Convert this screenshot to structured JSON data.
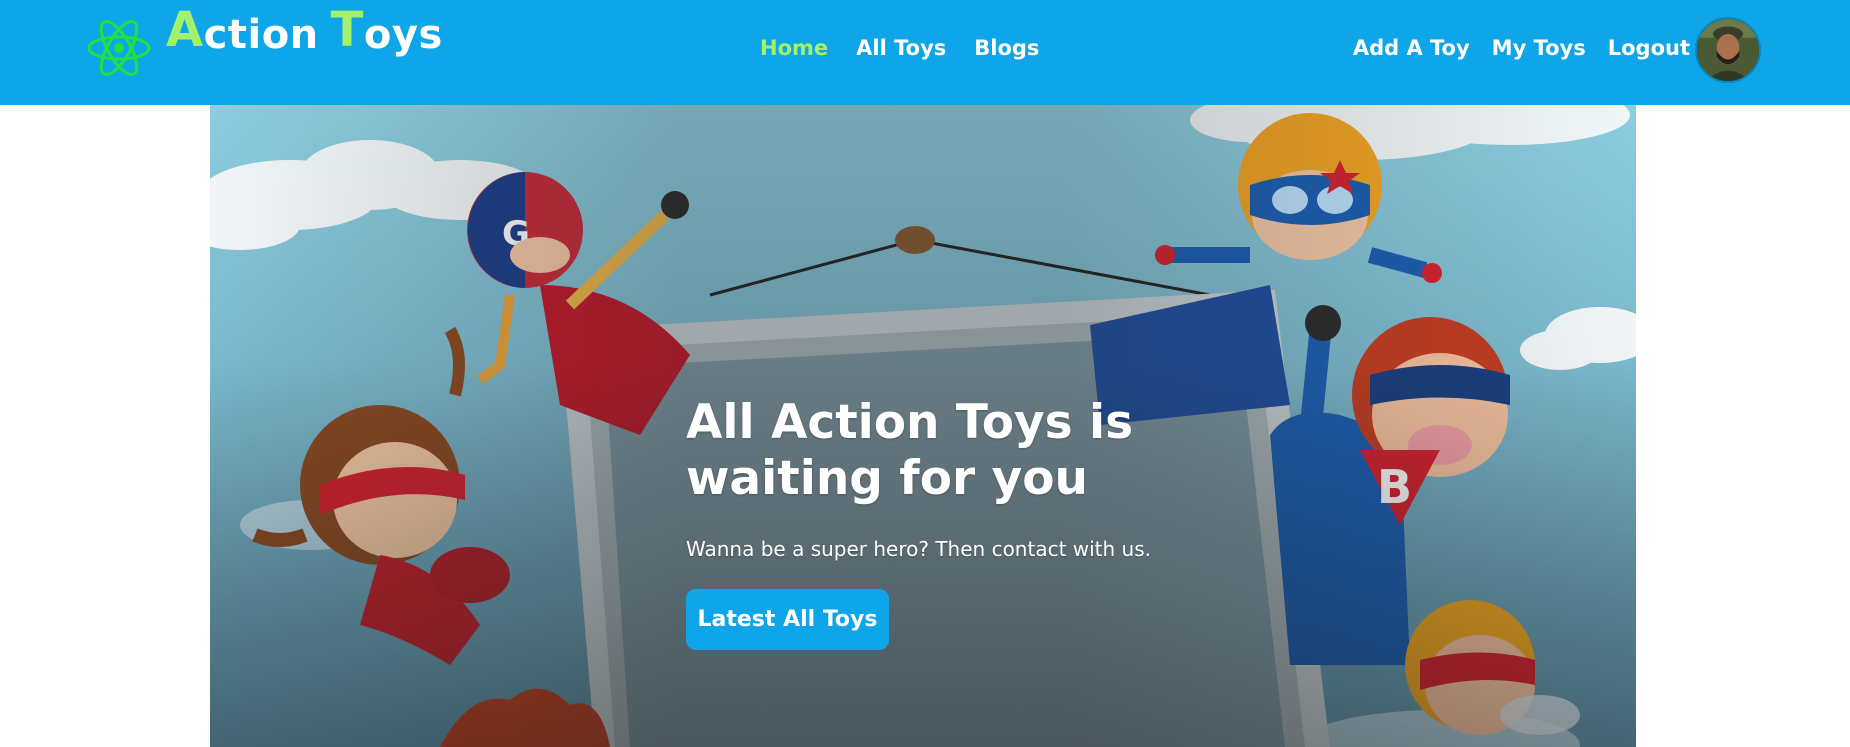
{
  "brand": {
    "name_first_cap": "A",
    "name_first_rest": "ction",
    "name_second_cap": "T",
    "name_second_rest": "oys",
    "icon": "atom-icon",
    "accent_color": "#a3f06b"
  },
  "nav": {
    "center": [
      {
        "label": "Home",
        "active": true
      },
      {
        "label": "All Toys",
        "active": false
      },
      {
        "label": "Blogs",
        "active": false
      }
    ],
    "right": [
      {
        "label": "Add A Toy"
      },
      {
        "label": "My Toys"
      },
      {
        "label": "Logout"
      }
    ],
    "avatar": "user-avatar-photo",
    "bar_color": "#0ea5e9"
  },
  "hero": {
    "title": "All Action Toys is waiting for you",
    "subtitle": "Wanna be a super hero? Then contact with us.",
    "button_label": "Latest All Toys",
    "image": "cartoon-superhero-kids-holding-sign"
  }
}
